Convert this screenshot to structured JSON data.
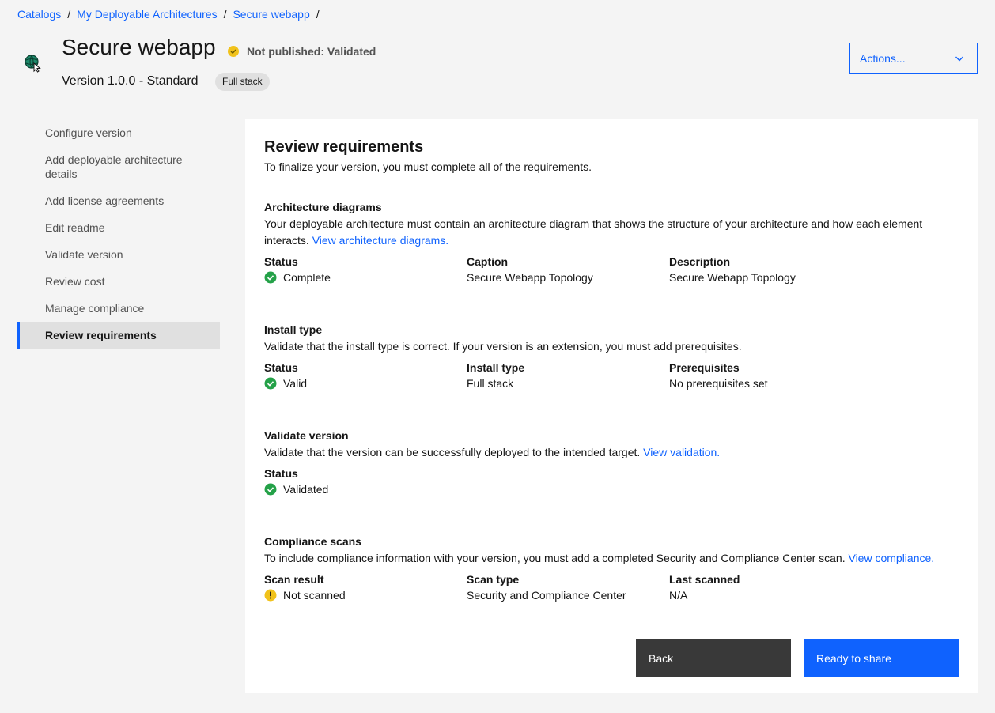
{
  "breadcrumb": {
    "items": [
      "Catalogs",
      "My Deployable Architectures",
      "Secure webapp"
    ],
    "separator": "/"
  },
  "header": {
    "title": "Secure webapp",
    "status": "Not published: Validated",
    "version": "Version 1.0.0 - Standard",
    "tag": "Full stack",
    "actions_label": "Actions..."
  },
  "sidenav": {
    "items": [
      "Configure version",
      "Add deployable architecture details",
      "Add license agreements",
      "Edit readme",
      "Validate version",
      "Review cost",
      "Manage compliance",
      "Review requirements"
    ],
    "active_index": 7
  },
  "main": {
    "title": "Review requirements",
    "subtitle": "To finalize your version, you must complete all of the requirements.",
    "architecture": {
      "title": "Architecture diagrams",
      "desc": "Your deployable architecture must contain an architecture diagram that shows the structure of your architecture and how each element interacts.",
      "link": "View architecture diagrams.",
      "labels": [
        "Status",
        "Caption",
        "Description"
      ],
      "status": "Complete",
      "caption": "Secure Webapp Topology",
      "description": "Secure Webapp Topology"
    },
    "install": {
      "title": "Install type",
      "desc": "Validate that the install type is correct. If your version is an extension, you must add prerequisites.",
      "labels": [
        "Status",
        "Install type",
        "Prerequisites"
      ],
      "status": "Valid",
      "install_type": "Full stack",
      "prerequisites": "No prerequisites set"
    },
    "validate": {
      "title": "Validate version",
      "desc": "Validate that the version can be successfully deployed to the intended target.",
      "link": "View validation.",
      "labels": [
        "Status"
      ],
      "status": "Validated"
    },
    "compliance": {
      "title": "Compliance scans",
      "desc": "To include compliance information with your version, you must add a completed Security and Compliance Center scan.",
      "link": "View compliance.",
      "labels": [
        "Scan result",
        "Scan type",
        "Last scanned"
      ],
      "result": "Not scanned",
      "scan_type": "Security and Compliance Center",
      "last_scanned": "N/A"
    },
    "buttons": {
      "back": "Back",
      "share": "Ready to share"
    }
  },
  "colors": {
    "accent": "#0f62fe",
    "success": "#24a148",
    "warning": "#f1c21b",
    "background": "#f4f4f4"
  }
}
